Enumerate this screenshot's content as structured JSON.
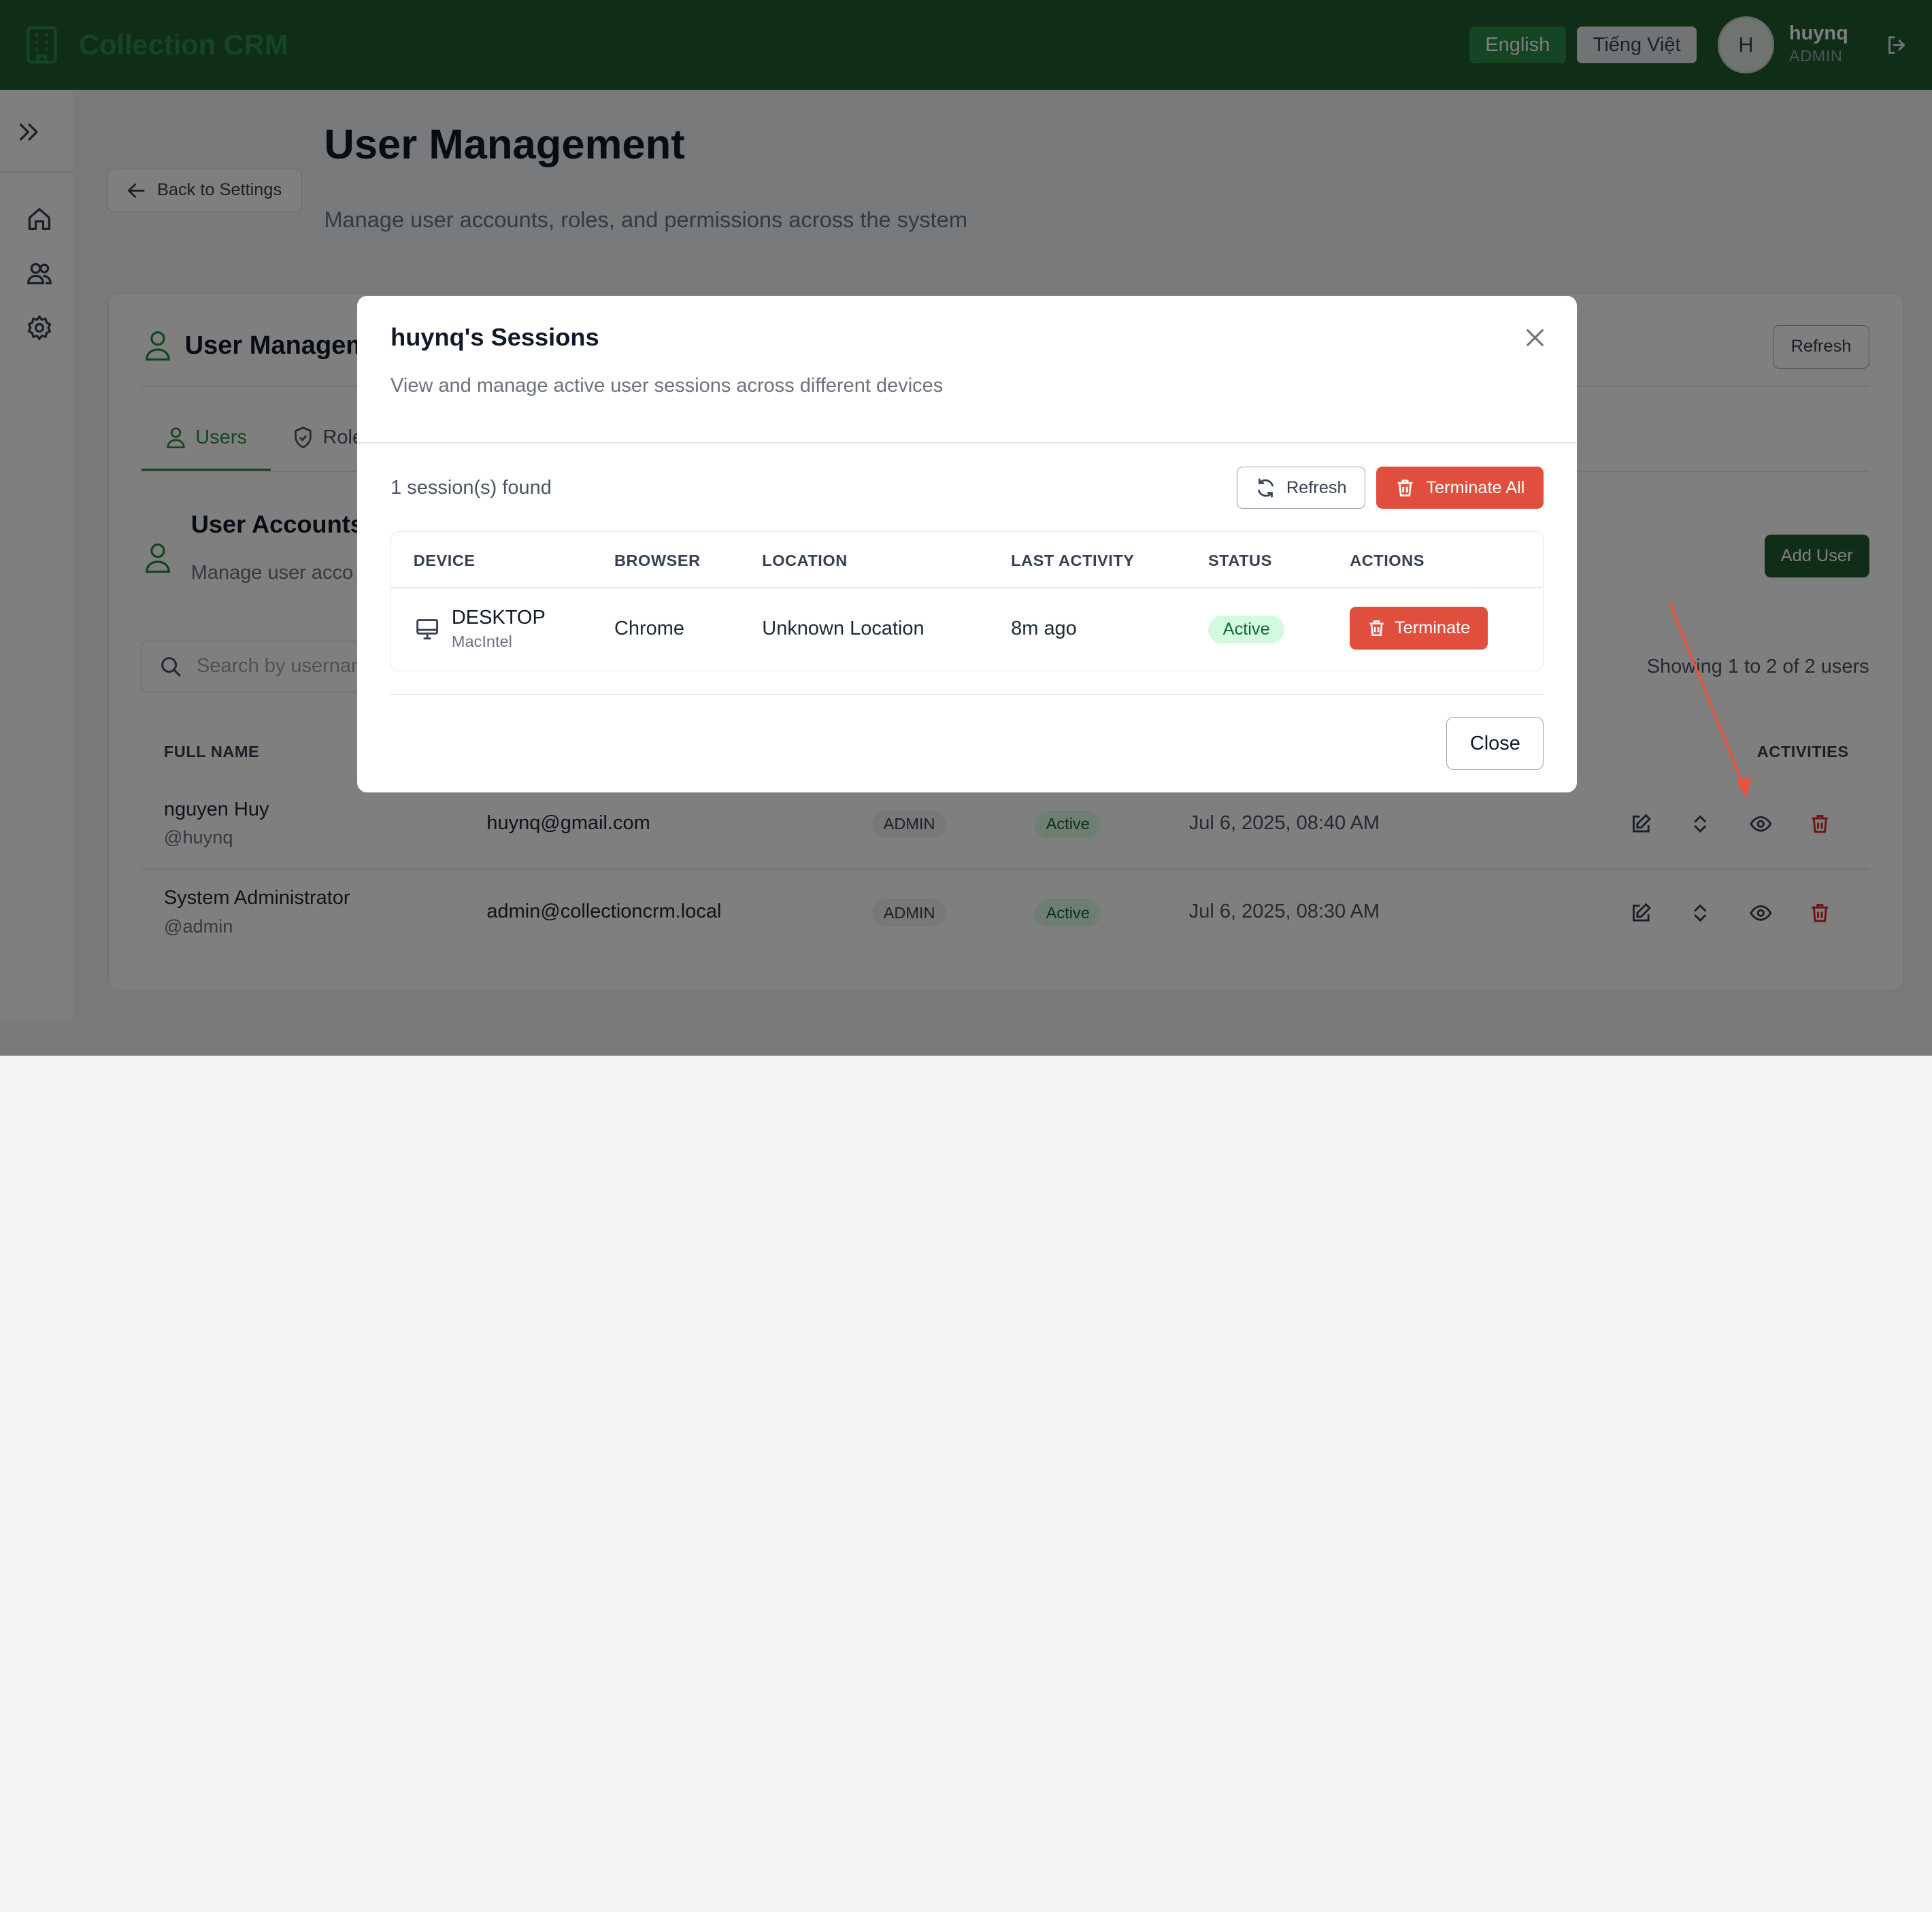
{
  "header": {
    "app_name": "Collection CRM",
    "lang_en": "English",
    "lang_vi": "Tiếng Việt",
    "avatar_initial": "H",
    "user_name": "huynq",
    "user_role": "ADMIN"
  },
  "page": {
    "back_label": "Back to Settings",
    "title": "User Management",
    "subtitle": "Manage user accounts, roles, and permissions across the system"
  },
  "card": {
    "title": "User Managem",
    "refresh_label": "Refresh",
    "tabs": [
      {
        "label": "Users"
      },
      {
        "label": "Role"
      }
    ],
    "accounts_title": "User Accounts",
    "accounts_sub": "Manage user acco",
    "add_user_label": "Add User",
    "search_placeholder": "Search by usernan",
    "showing_text": "Showing 1 to 2 of 2 users",
    "columns": {
      "full_name": "FULL NAME",
      "activities": "ACTIVITIES"
    },
    "rows": [
      {
        "name": "nguyen Huy",
        "username": "@huynq",
        "email": "huynq@gmail.com",
        "role": "ADMIN",
        "status": "Active",
        "date": "Jul 6, 2025, 08:40 AM"
      },
      {
        "name": "System Administrator",
        "username": "@admin",
        "email": "admin@collectioncrm.local",
        "role": "ADMIN",
        "status": "Active",
        "date": "Jul 6, 2025, 08:30 AM"
      }
    ]
  },
  "modal": {
    "title": "huynq's Sessions",
    "subtitle": "View and manage active user sessions across different devices",
    "count_text": "1 session(s) found",
    "refresh_label": "Refresh",
    "terminate_all_label": "Terminate All",
    "columns": {
      "device": "DEVICE",
      "browser": "BROWSER",
      "location": "LOCATION",
      "last_activity": "LAST ACTIVITY",
      "status": "STATUS",
      "actions": "ACTIONS"
    },
    "session": {
      "device": "DESKTOP",
      "platform": "MacIntel",
      "browser": "Chrome",
      "location": "Unknown Location",
      "last_activity": "8m ago",
      "status": "Active",
      "action_label": "Terminate"
    },
    "close_label": "Close"
  },
  "colors": {
    "brand_dark": "#1f5b2e",
    "brand_green": "#2b8a44",
    "danger": "#e04e3e",
    "annotation_arrow": "#e8533f"
  },
  "icons": [
    "building-icon",
    "logout-icon",
    "chevrons-right-icon",
    "home-icon",
    "users-icon",
    "gear-icon",
    "arrow-left-icon",
    "user-icon",
    "shield-icon",
    "search-icon",
    "edit-icon",
    "sort-icon",
    "eye-icon",
    "trash-icon",
    "close-icon",
    "refresh-icon",
    "monitor-icon"
  ]
}
